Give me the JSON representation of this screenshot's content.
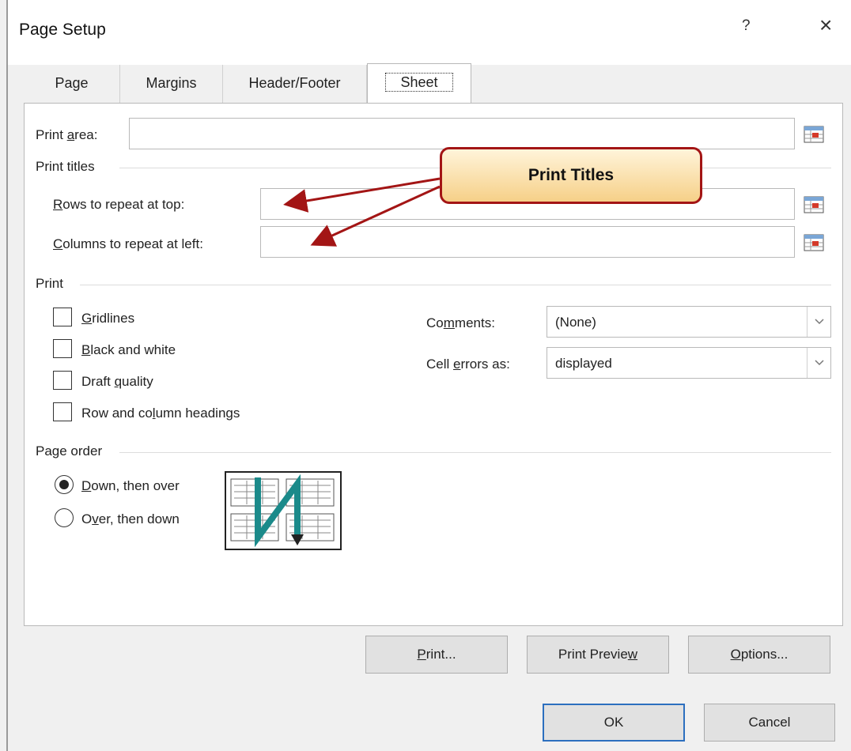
{
  "dialog": {
    "title": "Page Setup",
    "help": "?",
    "close": "×"
  },
  "tabs": [
    {
      "label": "Page"
    },
    {
      "label": "Margins"
    },
    {
      "label": "Header/Footer"
    },
    {
      "label": "Sheet",
      "active": true
    }
  ],
  "print_area": {
    "label_pre": "Print ",
    "label_ul": "a",
    "label_post": "rea:",
    "value": ""
  },
  "print_titles": {
    "group_label": "Print titles",
    "rows": {
      "label_ul": "R",
      "label_post": "ows to repeat at top:",
      "value": ""
    },
    "cols": {
      "label_ul": "C",
      "label_post": "olumns to repeat at left:",
      "value": ""
    }
  },
  "print_group": {
    "group_label": "Print",
    "gridlines": {
      "ul": "G",
      "post": "ridlines",
      "checked": false
    },
    "black_white": {
      "ul": "B",
      "post": "lack and white",
      "checked": false
    },
    "draft": {
      "pre": "Draft ",
      "ul": "q",
      "post": "uality",
      "checked": false
    },
    "headings": {
      "pre": "Row and co",
      "ul": "l",
      "post": "umn headings",
      "checked": false
    },
    "comments": {
      "pre": "Co",
      "ul": "m",
      "post": "ments:",
      "value": "(None)"
    },
    "cell_errors": {
      "pre": "Cell ",
      "ul": "e",
      "post": "rrors as:",
      "value": "displayed"
    }
  },
  "page_order": {
    "group_label": "Page order",
    "down_then_over": {
      "ul": "D",
      "post": "own, then over",
      "selected": true
    },
    "over_then_down": {
      "pre": "O",
      "ul": "v",
      "post": "er, then down",
      "selected": false
    }
  },
  "buttons": {
    "print": {
      "ul": "P",
      "post": "rint..."
    },
    "print_preview": {
      "pre": "Print Previe",
      "ul": "w"
    },
    "options": {
      "ul": "O",
      "post": "ptions..."
    },
    "ok": "OK",
    "cancel": "Cancel"
  },
  "annotation": {
    "callout_text": "Print Titles",
    "border_color": "#a31515",
    "fill_top": "#fff4da",
    "fill_bottom": "#f6d088"
  },
  "colors": {
    "diagram_arrow": "#1b8a8a",
    "primary_border": "#2c6fbf"
  }
}
